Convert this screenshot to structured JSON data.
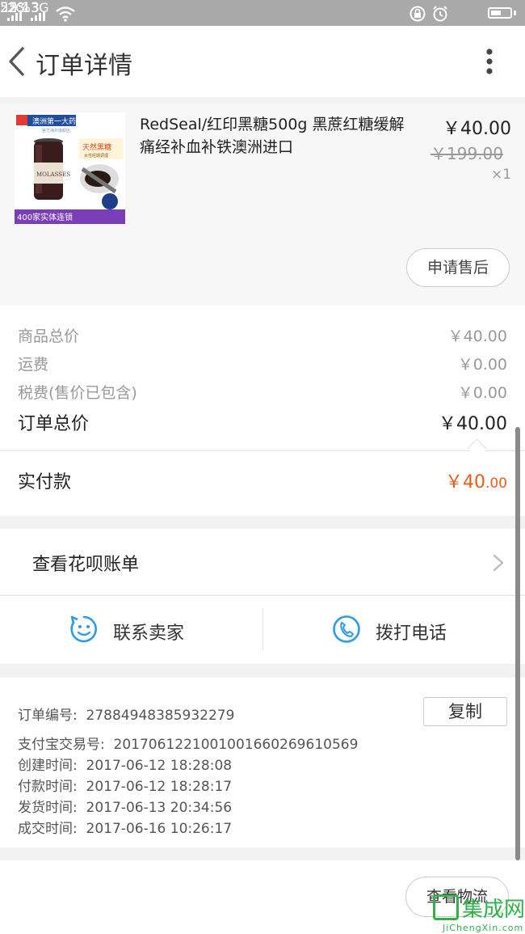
{
  "status_bar": {
    "net1": "2G",
    "net2": "3G",
    "time": "22:13",
    "battery": "55%",
    "battery_level": 0.55
  },
  "header": {
    "title": "订单详情"
  },
  "product": {
    "name": "RedSeal/红印黑糖500g 黑蔗红糖缓解痛经补血补铁澳洲进口",
    "price": "￥40.00",
    "original_price": "￥199.00",
    "quantity": "×1",
    "image": {
      "top_banner": "澳洲第一大药房",
      "banner_sub": "官方海外旗舰店",
      "badge": "天然黑糖",
      "badge_sub": "女性经期调理",
      "jar_label": "MOLASSES",
      "bottom_banner": "400家实体连锁"
    },
    "after_sale_label": "申请售后"
  },
  "costs": {
    "items": [
      {
        "label": "商品总价",
        "value": "￥40.00"
      },
      {
        "label": "运费",
        "value": "￥0.00"
      },
      {
        "label": "税费(售价已包含)",
        "value": "￥0.00"
      }
    ],
    "total_label": "订单总价",
    "total_value": "￥40.00",
    "paid_label": "实付款",
    "paid_int": "￥40",
    "paid_dec": ".00",
    "paid_color": "#f05a1a"
  },
  "huabei": {
    "label": "查看花呗账单"
  },
  "contact": {
    "seller_label": "联系卖家",
    "call_label": "拨打电话",
    "icon_color": "#2d9be8"
  },
  "order_info": {
    "order_no_label": "订单编号:",
    "order_no": "27884948385932279",
    "copy_label": "复制",
    "alipay_label": "支付宝交易号:",
    "alipay_no": "2017061221001001660269610569",
    "created_label": "创建时间:",
    "created": "2017-06-12 18:28:08",
    "paid_label": "付款时间:",
    "paid": "2017-06-12 18:28:17",
    "shipped_label": "发货时间:",
    "shipped": "2017-06-13 20:34:56",
    "done_label": "成交时间:",
    "done": "2017-06-16 10:26:17"
  },
  "bottom": {
    "logistics_label": "查看物流"
  },
  "watermark": {
    "main": "集成网",
    "sub": "JiChengXin.com"
  }
}
